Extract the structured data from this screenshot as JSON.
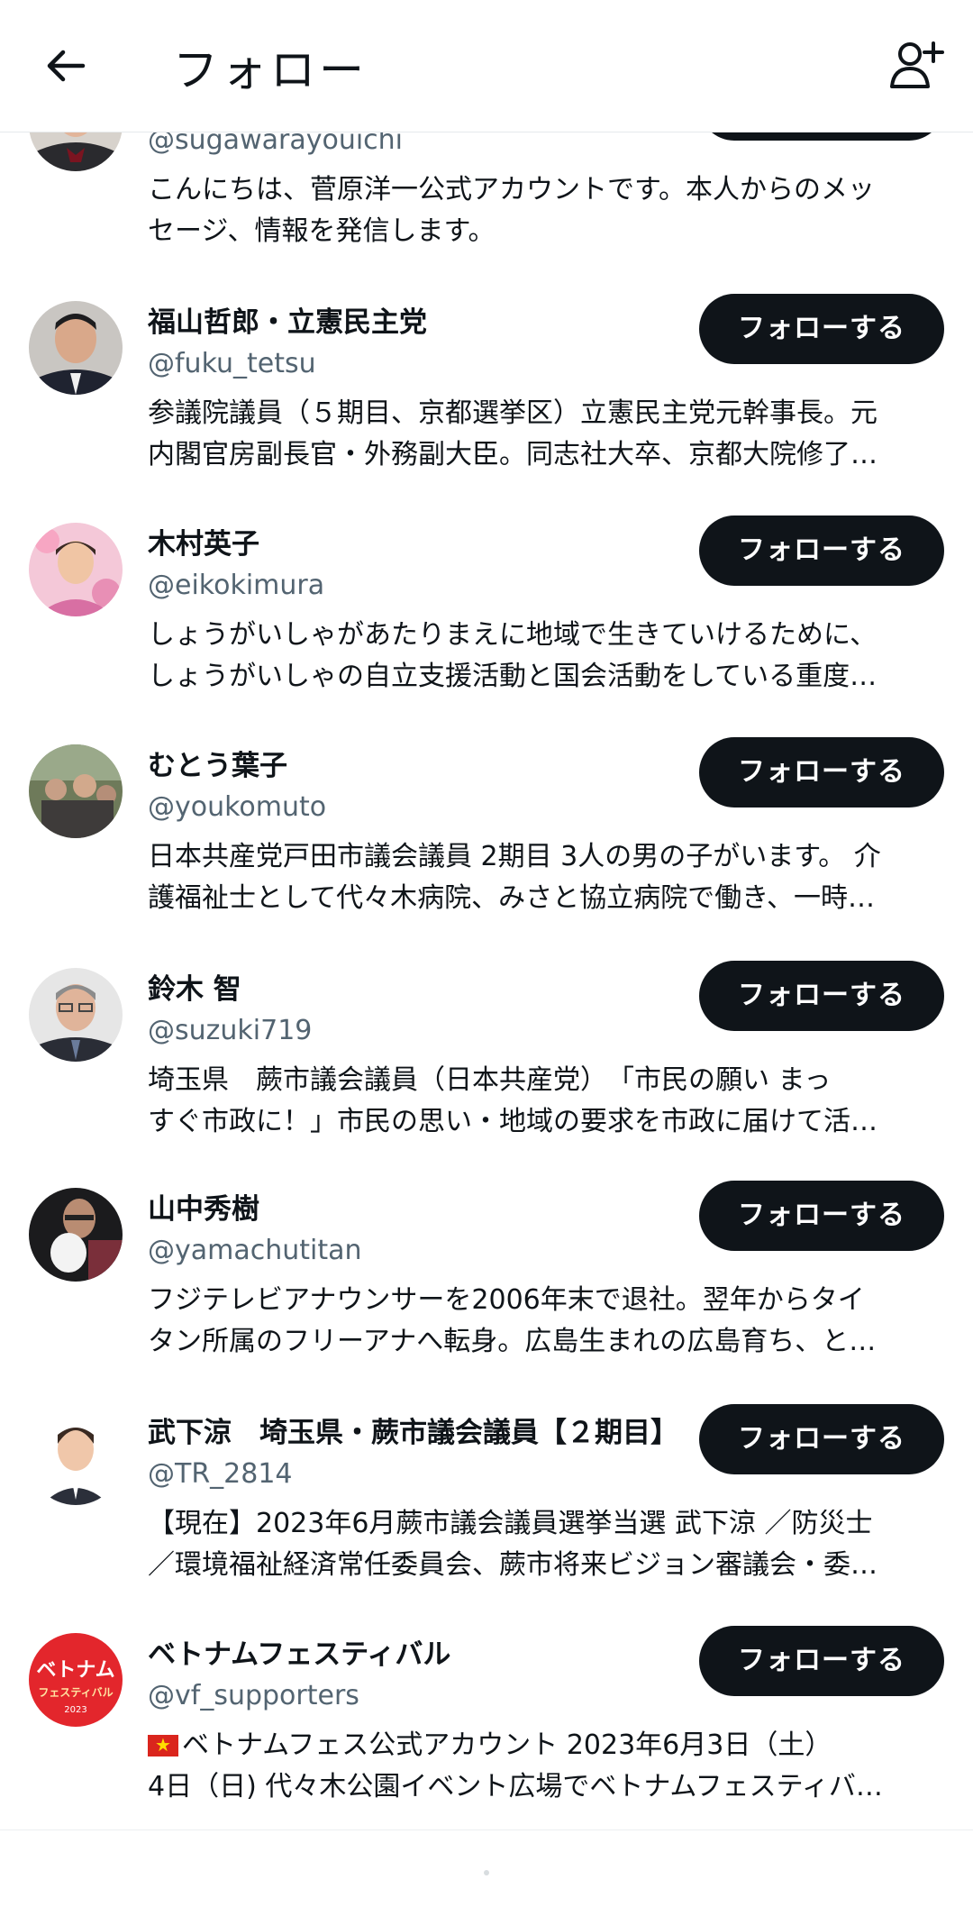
{
  "header": {
    "title": "フォロー",
    "back_icon": "arrow-left-icon",
    "add_icon": "add-user-icon"
  },
  "users": [
    {
      "name": "",
      "handle": "@sugawarayouichi",
      "bio": [
        "こんにちは、菅原洋一公式アカウントです。本人からのメッ",
        "セージ、情報を発信します。"
      ],
      "button": ""
    },
    {
      "name": "福山哲郎・立憲民主党",
      "handle": "@fuku_tetsu",
      "bio": [
        "参議院議員（５期目、京都選挙区）立憲民主党元幹事長。元",
        "内閣官房副長官・外務副大臣。同志社大卒、京都大院修了…"
      ],
      "button": "フォローする"
    },
    {
      "name": "木村英子",
      "handle": "@eikokimura",
      "bio": [
        "しょうがいしゃがあたりまえに地域で生きていけるために、",
        "しょうがいしゃの自立支援活動と国会活動をしている重度…"
      ],
      "button": "フォローする"
    },
    {
      "name": "むとう葉子",
      "handle": "@youkomuto",
      "bio": [
        "日本共産党戸田市議会議員 2期目 3人の男の子がいます。 介",
        "護福祉士として代々木病院、みさと協立病院で働き、一時…"
      ],
      "button": "フォローする"
    },
    {
      "name": "鈴木 智",
      "handle": "@suzuki719",
      "bio": [
        "埼玉県　蕨市議会議員（日本共産党）　「市民の願い まっ",
        "すぐ市政に！」市民の思い・地域の要求を市政に届けて活…"
      ],
      "button": "フォローする"
    },
    {
      "name": "山中秀樹",
      "handle": "@yamachutitan",
      "bio": [
        "フジテレビアナウンサーを2006年末で退社。翌年からタイ",
        "タン所属のフリーアナへ転身。広島生まれの広島育ち、と…"
      ],
      "button": "フォローする"
    },
    {
      "name": "武下涼　埼玉県・蕨市議会議員【２期目】",
      "handle": "@TR_2814",
      "bio": [
        "【現在】2023年6月蕨市議会議員選挙当選 武下涼 ／防災士",
        "／環境福祉経済常任委員会、蕨市将来ビジョン審議会・委…"
      ],
      "button": "フォローする"
    },
    {
      "name": "ベトナムフェスティバル",
      "handle": "@vf_supporters",
      "bio": [
        "ベトナムフェス公式アカウント 2023年6月3日（土）",
        "4日（日) 代々木公園イベント広場でベトナムフェスティバ…"
      ],
      "button": "フォローする"
    }
  ],
  "vf_logo": {
    "line1": "ベトナム",
    "line2": "フェスティバル",
    "year": "2023"
  },
  "colors": {
    "text": "#0f1419",
    "secondary": "#536471",
    "button_bg": "#0f1419",
    "button_text": "#ffffff"
  }
}
